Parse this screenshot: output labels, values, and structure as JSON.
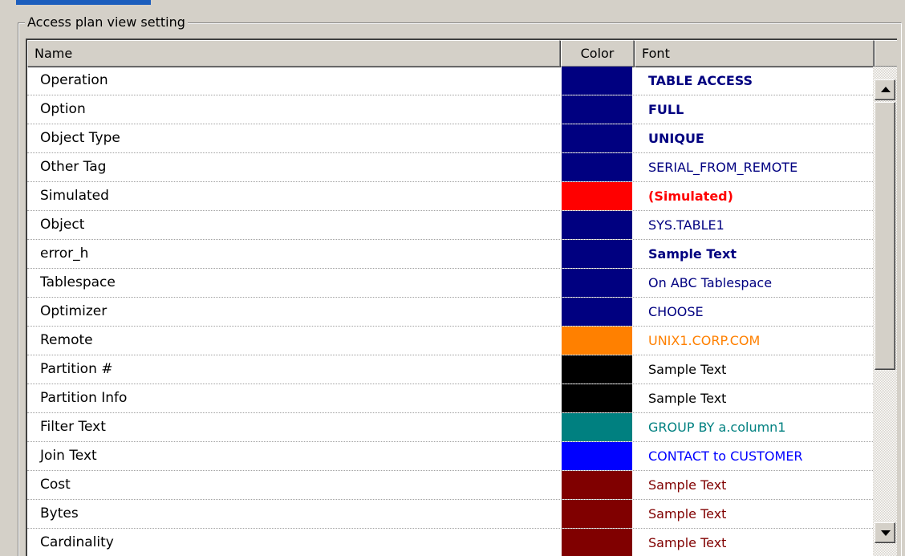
{
  "group": {
    "title": "Access plan view setting"
  },
  "columns": {
    "name": "Name",
    "color": "Color",
    "font": "Font"
  },
  "rows": [
    {
      "name": "Operation",
      "color": "#000080",
      "sample": "TABLE ACCESS",
      "sample_color": "#000080",
      "bold": true
    },
    {
      "name": "Option",
      "color": "#000080",
      "sample": "FULL",
      "sample_color": "#000080",
      "bold": true
    },
    {
      "name": "Object Type",
      "color": "#000080",
      "sample": "UNIQUE",
      "sample_color": "#000080",
      "bold": true
    },
    {
      "name": "Other Tag",
      "color": "#000080",
      "sample": "SERIAL_FROM_REMOTE",
      "sample_color": "#000080",
      "bold": false
    },
    {
      "name": "Simulated",
      "color": "#ff0000",
      "sample": "(Simulated)",
      "sample_color": "#ff0000",
      "bold": true
    },
    {
      "name": "Object",
      "color": "#000080",
      "sample": "SYS.TABLE1",
      "sample_color": "#000080",
      "bold": false
    },
    {
      "name": "error_h",
      "color": "#000080",
      "sample": "Sample Text",
      "sample_color": "#000080",
      "bold": true
    },
    {
      "name": "Tablespace",
      "color": "#000080",
      "sample": "On ABC Tablespace",
      "sample_color": "#000080",
      "bold": false
    },
    {
      "name": "Optimizer",
      "color": "#000080",
      "sample": "CHOOSE",
      "sample_color": "#000080",
      "bold": false
    },
    {
      "name": "Remote",
      "color": "#ff8000",
      "sample": "UNIX1.CORP.COM",
      "sample_color": "#ff8000",
      "bold": false
    },
    {
      "name": "Partition #",
      "color": "#000000",
      "sample": "Sample Text",
      "sample_color": "#000000",
      "bold": false
    },
    {
      "name": "Partition Info",
      "color": "#000000",
      "sample": "Sample Text",
      "sample_color": "#000000",
      "bold": false
    },
    {
      "name": "Filter Text",
      "color": "#008080",
      "sample": "GROUP BY a.column1",
      "sample_color": "#008080",
      "bold": false
    },
    {
      "name": "Join Text",
      "color": "#0000ff",
      "sample": "CONTACT to CUSTOMER",
      "sample_color": "#0000ff",
      "bold": false
    },
    {
      "name": "Cost",
      "color": "#800000",
      "sample": "Sample Text",
      "sample_color": "#800000",
      "bold": false
    },
    {
      "name": "Bytes",
      "color": "#800000",
      "sample": "Sample Text",
      "sample_color": "#800000",
      "bold": false
    },
    {
      "name": "Cardinality",
      "color": "#800000",
      "sample": "Sample Text",
      "sample_color": "#800000",
      "bold": false
    }
  ],
  "scrollbar": {
    "up_icon": "arrow-up-icon",
    "down_icon": "arrow-down-icon",
    "position": 0.0
  }
}
